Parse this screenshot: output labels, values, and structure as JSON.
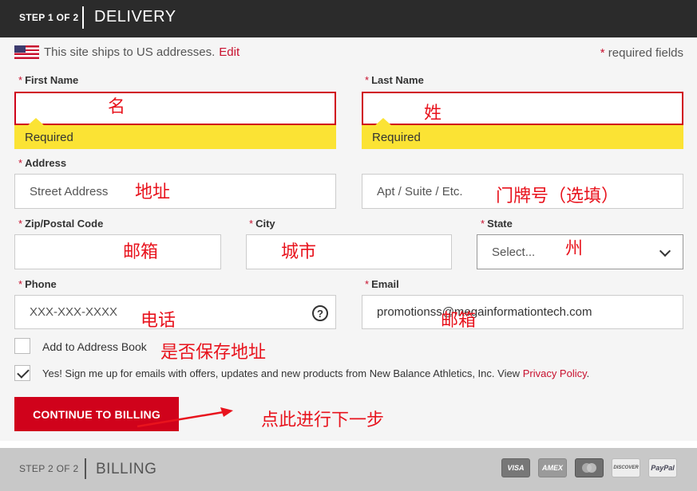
{
  "header": {
    "step": "STEP 1 OF 2",
    "title": "DELIVERY"
  },
  "shipping_note": {
    "text": "This site ships to US addresses.",
    "edit_link": "Edit"
  },
  "required_note": {
    "star": "*",
    "text": "required fields"
  },
  "form": {
    "first_name": {
      "label": "First Name",
      "error": "Required"
    },
    "last_name": {
      "label": "Last Name",
      "error": "Required"
    },
    "address": {
      "label": "Address",
      "placeholder": "Street Address",
      "apt_placeholder": "Apt / Suite / Etc."
    },
    "zip": {
      "label": "Zip/Postal Code"
    },
    "city": {
      "label": "City"
    },
    "state": {
      "label": "State",
      "selected": "Select..."
    },
    "phone": {
      "label": "Phone",
      "placeholder": "XXX-XXX-XXXX",
      "help": "?"
    },
    "email": {
      "label": "Email",
      "value": "promotionss@megainformationtech.com"
    },
    "add_to_address_book": {
      "label": "Add to Address Book",
      "checked": false
    },
    "newsletter": {
      "text": "Yes! Sign me up for emails with offers, updates and new products from New Balance Athletics, Inc. View",
      "link": "Privacy Policy",
      "after": ".",
      "checked": true
    }
  },
  "cta": {
    "label": "CONTINUE TO BILLING"
  },
  "annotations": {
    "first_name": "名",
    "last_name": "姓",
    "address": "地址",
    "apt": "门牌号（选填）",
    "zip": "邮箱",
    "city": "城市",
    "state": "州",
    "phone": "电话",
    "email": "邮箱",
    "address_book": "是否保存地址",
    "continue": "点此进行下一步"
  },
  "footer": {
    "step": "STEP 2 OF 2",
    "title": "BILLING",
    "cards": [
      {
        "name": "VISA",
        "color": "#777777"
      },
      {
        "name": "AMEX",
        "color": "#9a9a9a"
      },
      {
        "name": "",
        "color": "#6f6f6f"
      },
      {
        "name": "DISCOVER",
        "color": "#ededed"
      },
      {
        "name": "PayPal",
        "color": "#ededed"
      }
    ]
  },
  "colors": {
    "accent": "#d0021b",
    "error_bg": "#fbe334",
    "header_bg": "#2b2b2b",
    "annotation": "#e8131d"
  }
}
